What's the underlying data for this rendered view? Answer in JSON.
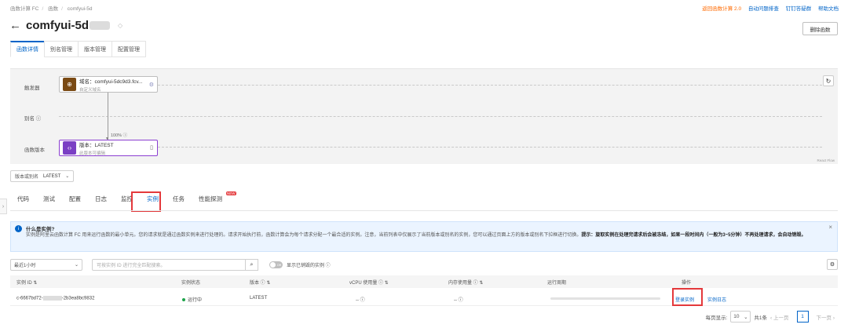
{
  "breadcrumb": [
    "函数计算 FC",
    "函数",
    "comfyui-5d"
  ],
  "toplinks": {
    "l1": "返回函数计算 2.0",
    "l2": "自动问题排查",
    "l3": "钉钉答疑群",
    "l4": "帮助文档"
  },
  "header": {
    "title": "comfyui-5d",
    "delete_label": "删除函数"
  },
  "tabs": [
    "函数详情",
    "别名管理",
    "版本管理",
    "配置管理"
  ],
  "flow": {
    "row_trigger": "触发器",
    "row_alias": "别名 ⓘ",
    "row_version": "函数版本",
    "trigger_node": {
      "title": "域名：comfyui-5dc9d3.fcv...",
      "sub": "自定义域名"
    },
    "version_node": {
      "title": "版本：LATEST",
      "sub": "此版本可编辑"
    },
    "percent": "100% ⓘ",
    "react_flow": "React Flow"
  },
  "version_select": {
    "label": "版本或别名",
    "value": "LATEST"
  },
  "subtabs": [
    "代码",
    "测试",
    "配置",
    "日志",
    "监控",
    "实例",
    "任务",
    "性能探测"
  ],
  "new_badge": "NEW",
  "notice": {
    "title": "什么是实例?",
    "body": "实例是阿里云函数计算 FC 用来运行函数的最小单元。您的请求就是通过函数实例来进行处理的。请求开始执行前，函数计算会为每个请求分配一个最合适的实例。注意，当前列表中仅展示了当前版本或别名的实例，您可以通过页面上方的版本或别名下拉框进行切换。",
    "tip": "提示：旋取实例在处理完请求后会被冻结，如果一段时间内（一般为3~5分钟）不再处理请求，会自动销毁。"
  },
  "filters": {
    "time": "最近1小时",
    "search_placeholder": "可按实例 ID 进行完全匹配搜索。",
    "toggle": "Off",
    "show_destroyed": "显示已销毁的实例 ⓘ"
  },
  "table": {
    "headers": [
      "实例 ID ⇅",
      "实例状态",
      "版本 ⓘ ⇅",
      "vCPU 使用量 ⓘ ⇅",
      "内存使用量 ⓘ ⇅",
      "运行周期",
      "操作"
    ],
    "row": {
      "id": "c-6667bd72-",
      "id_tail": "-2b3ea8bc9832",
      "status": "运行中",
      "version": "LATEST",
      "vcpu": "-- ⓘ",
      "mem": "-- ⓘ",
      "login": "登录实例",
      "logs": "实例日志"
    }
  },
  "pager": {
    "per_page_label": "每页显示:",
    "per_page": "10",
    "total": "共1条",
    "prev": "上一页",
    "page": "1",
    "next": "下一页"
  },
  "colors": {
    "accent": "#0064c8",
    "highlight": "#e4393c",
    "running": "#1ea34a"
  }
}
